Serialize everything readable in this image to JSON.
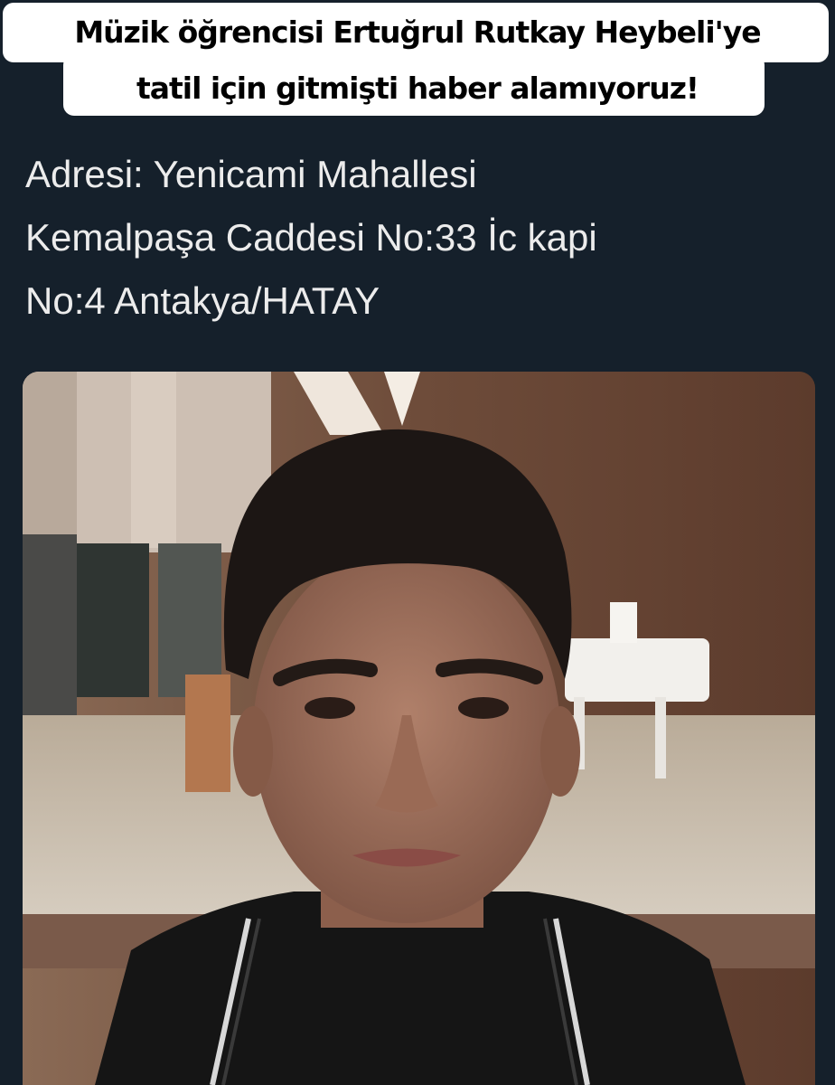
{
  "caption": {
    "line1": "Müzik öğrencisi Ertuğrul Rutkay Heybeli'ye",
    "line2": "tatil için gitmişti haber alamıyoruz!"
  },
  "tweet": {
    "lines": [
      "Adresi: Yenicami Mahallesi",
      "Kemalpaşa Caddesi No:33 İc kapi",
      "No:4 Antakya/HATAY"
    ]
  },
  "photo": {
    "subject": "selfie of young man in hotel lobby with white piano"
  },
  "colors": {
    "background": "#15202b",
    "caption_box": "#ffffff",
    "caption_text": "#000000",
    "tweet_text": "#ececec"
  }
}
